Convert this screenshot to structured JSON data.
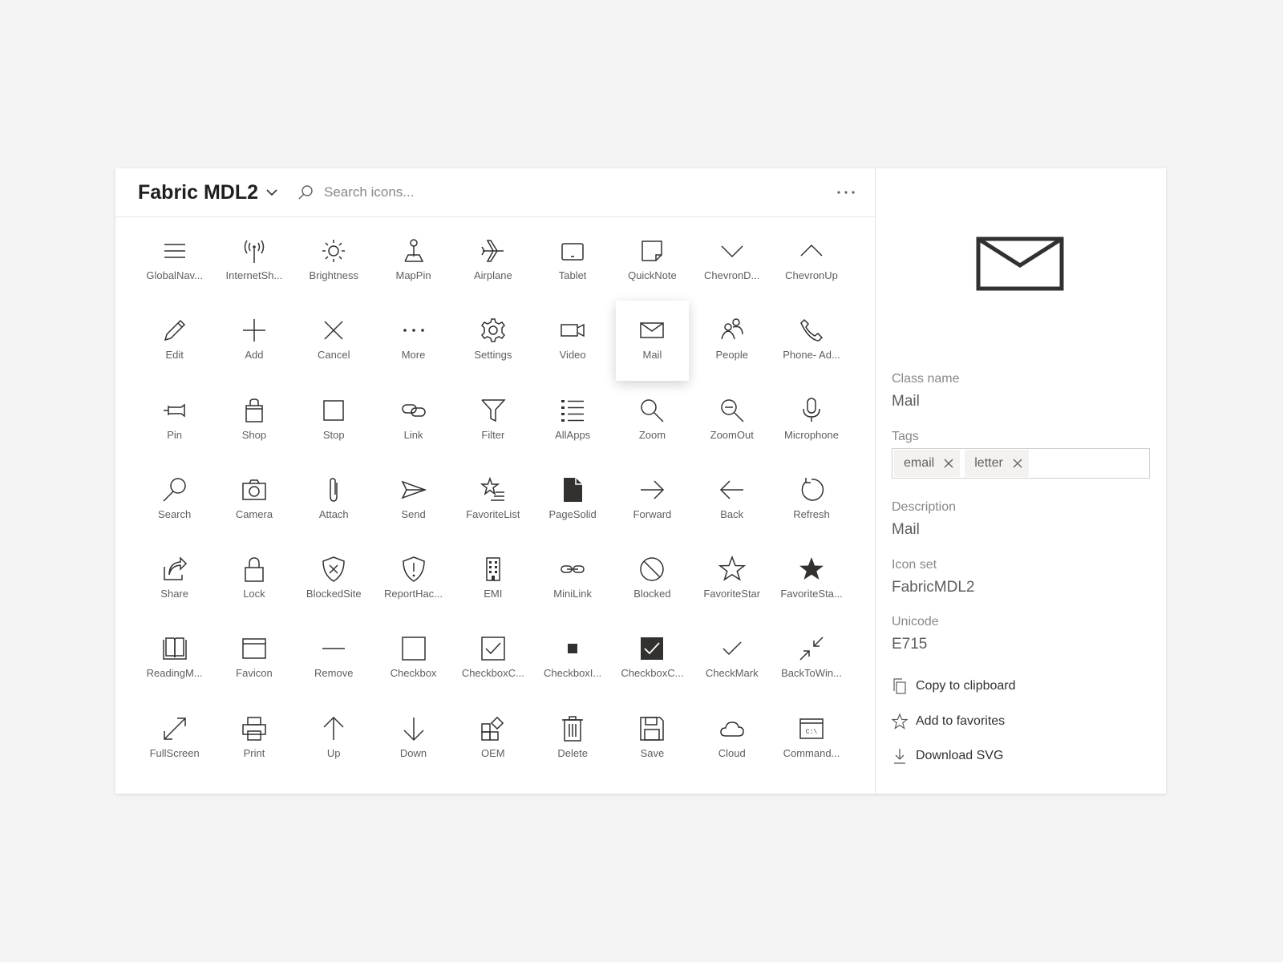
{
  "header": {
    "set_title": "Fabric MDL2",
    "search_placeholder": "Search icons..."
  },
  "icons": [
    {
      "label": "GlobalNav...",
      "icon": "global-nav-icon"
    },
    {
      "label": "InternetSh...",
      "icon": "internet-sharing-icon"
    },
    {
      "label": "Brightness",
      "icon": "brightness-icon"
    },
    {
      "label": "MapPin",
      "icon": "map-pin-icon"
    },
    {
      "label": "Airplane",
      "icon": "airplane-icon"
    },
    {
      "label": "Tablet",
      "icon": "tablet-icon"
    },
    {
      "label": "QuickNote",
      "icon": "quick-note-icon"
    },
    {
      "label": "ChevronD...",
      "icon": "chevron-down-icon"
    },
    {
      "label": "ChevronUp",
      "icon": "chevron-up-icon"
    },
    {
      "label": "Edit",
      "icon": "edit-icon"
    },
    {
      "label": "Add",
      "icon": "add-icon"
    },
    {
      "label": "Cancel",
      "icon": "cancel-icon"
    },
    {
      "label": "More",
      "icon": "more-icon"
    },
    {
      "label": "Settings",
      "icon": "settings-icon"
    },
    {
      "label": "Video",
      "icon": "video-icon"
    },
    {
      "label": "Mail",
      "icon": "mail-icon",
      "selected": true
    },
    {
      "label": "People",
      "icon": "people-icon"
    },
    {
      "label": "Phone- Ad...",
      "icon": "phone-icon"
    },
    {
      "label": "Pin",
      "icon": "pin-icon"
    },
    {
      "label": "Shop",
      "icon": "shop-icon"
    },
    {
      "label": "Stop",
      "icon": "stop-icon"
    },
    {
      "label": "Link",
      "icon": "link-icon"
    },
    {
      "label": "Filter",
      "icon": "filter-icon"
    },
    {
      "label": "AllApps",
      "icon": "all-apps-icon"
    },
    {
      "label": "Zoom",
      "icon": "zoom-icon"
    },
    {
      "label": "ZoomOut",
      "icon": "zoom-out-icon"
    },
    {
      "label": "Microphone",
      "icon": "microphone-icon"
    },
    {
      "label": "Search",
      "icon": "search-icon"
    },
    {
      "label": "Camera",
      "icon": "camera-icon"
    },
    {
      "label": "Attach",
      "icon": "attach-icon"
    },
    {
      "label": "Send",
      "icon": "send-icon"
    },
    {
      "label": "FavoriteList",
      "icon": "favorite-list-icon"
    },
    {
      "label": "PageSolid",
      "icon": "page-solid-icon"
    },
    {
      "label": "Forward",
      "icon": "forward-icon"
    },
    {
      "label": "Back",
      "icon": "back-icon"
    },
    {
      "label": "Refresh",
      "icon": "refresh-icon"
    },
    {
      "label": "Share",
      "icon": "share-icon"
    },
    {
      "label": "Lock",
      "icon": "lock-icon"
    },
    {
      "label": "BlockedSite",
      "icon": "blocked-site-icon"
    },
    {
      "label": "ReportHac...",
      "icon": "report-hacked-icon"
    },
    {
      "label": "EMI",
      "icon": "emi-icon"
    },
    {
      "label": "MiniLink",
      "icon": "mini-link-icon"
    },
    {
      "label": "Blocked",
      "icon": "blocked-icon"
    },
    {
      "label": "FavoriteStar",
      "icon": "favorite-star-icon"
    },
    {
      "label": "FavoriteSta...",
      "icon": "favorite-star-fill-icon"
    },
    {
      "label": "ReadingM...",
      "icon": "reading-mode-icon"
    },
    {
      "label": "Favicon",
      "icon": "favicon-icon"
    },
    {
      "label": "Remove",
      "icon": "remove-icon"
    },
    {
      "label": "Checkbox",
      "icon": "checkbox-icon"
    },
    {
      "label": "CheckboxC...",
      "icon": "checkbox-composite-icon"
    },
    {
      "label": "CheckboxI...",
      "icon": "checkbox-indeterminate-icon"
    },
    {
      "label": "CheckboxC...",
      "icon": "checkbox-composite-reversed-icon"
    },
    {
      "label": "CheckMark",
      "icon": "check-mark-icon"
    },
    {
      "label": "BackToWin...",
      "icon": "back-to-window-icon"
    },
    {
      "label": "FullScreen",
      "icon": "full-screen-icon"
    },
    {
      "label": "Print",
      "icon": "print-icon"
    },
    {
      "label": "Up",
      "icon": "up-icon"
    },
    {
      "label": "Down",
      "icon": "down-icon"
    },
    {
      "label": "OEM",
      "icon": "oem-icon"
    },
    {
      "label": "Delete",
      "icon": "delete-icon"
    },
    {
      "label": "Save",
      "icon": "save-icon"
    },
    {
      "label": "Cloud",
      "icon": "cloud-icon"
    },
    {
      "label": "Command...",
      "icon": "command-prompt-icon"
    }
  ],
  "details": {
    "preview_icon": "mail-icon",
    "class_name_label": "Class name",
    "class_name": "Mail",
    "tags_label": "Tags",
    "tags": [
      "email",
      "letter"
    ],
    "description_label": "Description",
    "description": "Mail",
    "icon_set_label": "Icon set",
    "icon_set": "FabricMDL2",
    "unicode_label": "Unicode",
    "unicode": "E715",
    "actions": {
      "copy": "Copy to clipboard",
      "favorite": "Add to favorites",
      "download": "Download SVG"
    }
  },
  "colors": {
    "background": "#f4f4f4",
    "card": "#ffffff",
    "icon_stroke": "#323130",
    "label_text": "#605e5c",
    "muted_text": "#8a8886"
  }
}
